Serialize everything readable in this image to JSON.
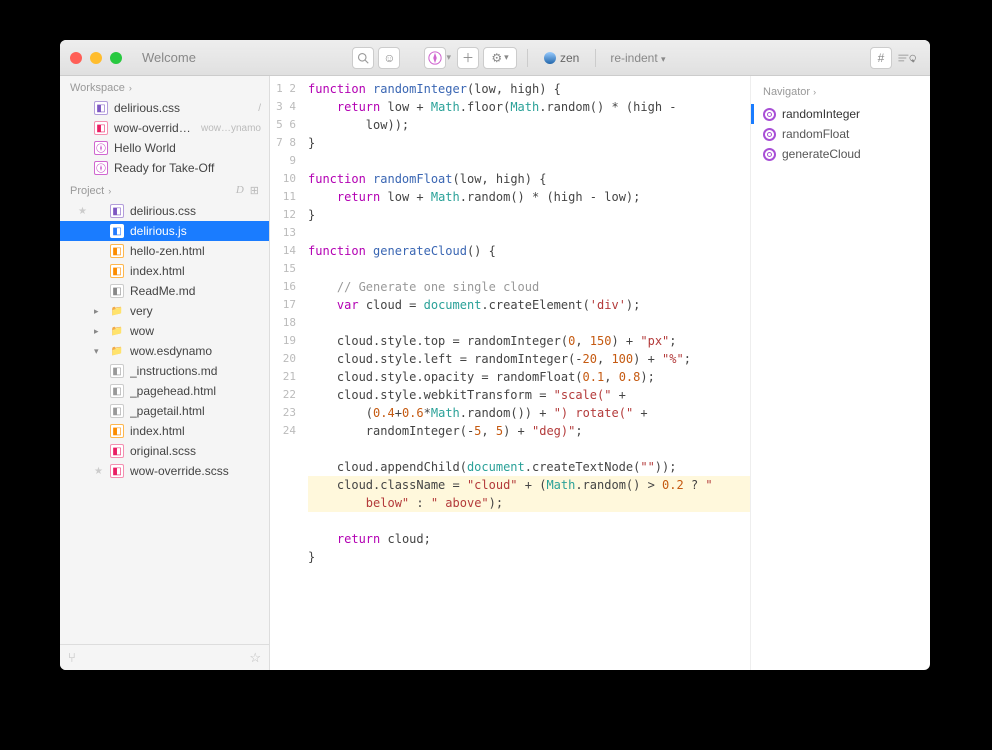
{
  "titlebar": {
    "tab_label": "Welcome"
  },
  "toolbar": {
    "zen_label": "zen",
    "reindent_label": "re-indent"
  },
  "sidebar": {
    "workspace_label": "Workspace",
    "project_label": "Project",
    "workspace_items": [
      {
        "name": "delirious.css",
        "icon": "css",
        "meta": "/"
      },
      {
        "name": "wow-override.scss",
        "icon": "scss",
        "meta": "wow…ynamo"
      },
      {
        "name": "Hello World",
        "icon": "comp"
      },
      {
        "name": "Ready for Take-Off",
        "icon": "comp"
      }
    ],
    "project_items": [
      {
        "name": "delirious.css",
        "icon": "css",
        "star": true
      },
      {
        "name": "delirious.js",
        "icon": "js",
        "sel": true
      },
      {
        "name": "hello-zen.html",
        "icon": "html"
      },
      {
        "name": "index.html",
        "icon": "html"
      },
      {
        "name": "ReadMe.md",
        "icon": "md"
      },
      {
        "name": "very",
        "icon": "folder",
        "collapsed": true
      },
      {
        "name": "wow",
        "icon": "folder",
        "collapsed": true
      },
      {
        "name": "wow.esdynamo",
        "icon": "folder",
        "collapsed": false
      }
    ],
    "project_children": [
      {
        "name": "_instructions.md",
        "icon": "file"
      },
      {
        "name": "_pagehead.html",
        "icon": "file"
      },
      {
        "name": "_pagetail.html",
        "icon": "file"
      },
      {
        "name": "index.html",
        "icon": "html"
      },
      {
        "name": "original.scss",
        "icon": "scss"
      },
      {
        "name": "wow-override.scss",
        "icon": "scss",
        "star": true
      }
    ]
  },
  "editor": {
    "line_count": 24,
    "lines": [
      {
        "t": "function",
        "c": "kw"
      },
      {
        "t": " "
      },
      {
        "t": "randomInteger",
        "c": "fn"
      },
      {
        "t": "(low, high) {"
      },
      "NL",
      "IND",
      {
        "t": "return",
        "c": "kw"
      },
      {
        "t": " low + "
      },
      {
        "t": "Math",
        "c": "cls"
      },
      {
        "t": ".floor("
      },
      {
        "t": "Math",
        "c": "cls"
      },
      {
        "t": ".random() * (high - "
      },
      "WRAP",
      {
        "t": "low));"
      },
      "NL",
      {
        "t": "}"
      },
      "NL",
      "BLANK",
      {
        "t": "function",
        "c": "kw"
      },
      {
        "t": " "
      },
      {
        "t": "randomFloat",
        "c": "fn"
      },
      {
        "t": "(low, high) {"
      },
      "NL",
      "IND",
      {
        "t": "return",
        "c": "kw"
      },
      {
        "t": " low + "
      },
      {
        "t": "Math",
        "c": "cls"
      },
      {
        "t": ".random() * (high - low);"
      },
      "NL",
      {
        "t": "}"
      },
      "NL",
      "BLANK",
      {
        "t": "function",
        "c": "kw"
      },
      {
        "t": " "
      },
      {
        "t": "generateCloud",
        "c": "fn"
      },
      {
        "t": "() {"
      },
      "NL",
      "BLANK",
      "IND",
      {
        "t": "// Generate one single cloud",
        "c": "cmt"
      },
      "NL",
      "IND",
      {
        "t": "var",
        "c": "kw"
      },
      {
        "t": " cloud = "
      },
      {
        "t": "document",
        "c": "cls"
      },
      {
        "t": ".createElement("
      },
      {
        "t": "'div'",
        "c": "str"
      },
      {
        "t": ");"
      },
      "NL",
      "BLANK",
      "IND",
      {
        "t": "cloud.style.top = randomInteger("
      },
      {
        "t": "0",
        "c": "num"
      },
      {
        "t": ", "
      },
      {
        "t": "150",
        "c": "num"
      },
      {
        "t": ") + "
      },
      {
        "t": "\"px\"",
        "c": "str"
      },
      {
        "t": ";"
      },
      "NL",
      "IND",
      {
        "t": "cloud.style.left = randomInteger(-"
      },
      {
        "t": "20",
        "c": "num"
      },
      {
        "t": ", "
      },
      {
        "t": "100",
        "c": "num"
      },
      {
        "t": ") + "
      },
      {
        "t": "\"%\"",
        "c": "str"
      },
      {
        "t": ";"
      },
      "NL",
      "IND",
      {
        "t": "cloud.style.opacity = randomFloat("
      },
      {
        "t": "0.1",
        "c": "num"
      },
      {
        "t": ", "
      },
      {
        "t": "0.8",
        "c": "num"
      },
      {
        "t": ");"
      },
      "NL",
      "IND",
      {
        "t": "cloud.style.webkitTransform = "
      },
      {
        "t": "\"scale(\"",
        "c": "str"
      },
      {
        "t": " + "
      },
      "WRAP",
      {
        "t": "("
      },
      {
        "t": "0.4",
        "c": "num"
      },
      {
        "t": "+"
      },
      {
        "t": "0.6",
        "c": "num"
      },
      {
        "t": "*"
      },
      {
        "t": "Math",
        "c": "cls"
      },
      {
        "t": ".random()) + "
      },
      {
        "t": "\") rotate(\"",
        "c": "str"
      },
      {
        "t": " + "
      },
      "WRAP",
      {
        "t": "randomInteger(-"
      },
      {
        "t": "5",
        "c": "num"
      },
      {
        "t": ", "
      },
      {
        "t": "5",
        "c": "num"
      },
      {
        "t": ") + "
      },
      {
        "t": "\"deg)\"",
        "c": "str"
      },
      {
        "t": ";"
      },
      "NL",
      "BLANK",
      "IND",
      {
        "t": "cloud.appendChild("
      },
      {
        "t": "document",
        "c": "cls"
      },
      {
        "t": ".createTextNode("
      },
      {
        "t": "\"\"",
        "c": "str"
      },
      {
        "t": "));"
      },
      "NL",
      "HL",
      "IND",
      {
        "t": "cloud.className = "
      },
      {
        "t": "\"cloud\"",
        "c": "str"
      },
      {
        "t": " + ("
      },
      {
        "t": "Math",
        "c": "cls"
      },
      {
        "t": ".random() > "
      },
      {
        "t": "0.2",
        "c": "num"
      },
      {
        "t": " ? "
      },
      {
        "t": "\" ",
        "c": "str"
      },
      "WRAPHL",
      {
        "t": "below\"",
        "c": "str"
      },
      {
        "t": " : "
      },
      {
        "t": "\" above\"",
        "c": "str"
      },
      {
        "t": ");"
      },
      "NL",
      "BLANK",
      "IND",
      {
        "t": "return",
        "c": "kw"
      },
      {
        "t": " cloud;"
      },
      "NL",
      {
        "t": "}"
      },
      "NL",
      "BLANK"
    ]
  },
  "navigator": {
    "label": "Navigator",
    "items": [
      {
        "name": "randomInteger",
        "sel": true
      },
      {
        "name": "randomFloat"
      },
      {
        "name": "generateCloud"
      }
    ]
  }
}
